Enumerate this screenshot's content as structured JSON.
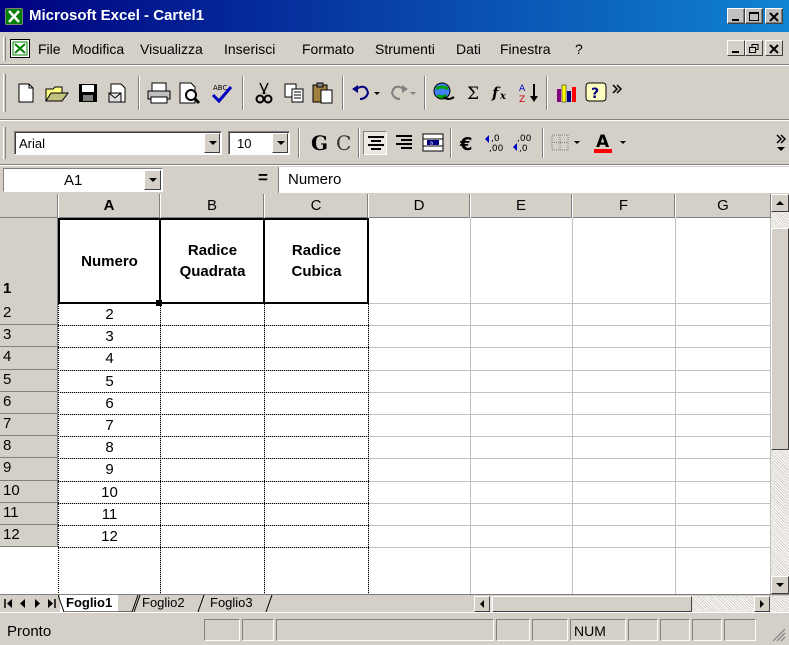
{
  "window": {
    "title": "Microsoft Excel - Cartel1"
  },
  "menu": {
    "items": [
      "File",
      "Modifica",
      "Visualizza",
      "Inserisci",
      "Formato",
      "Strumenti",
      "Dati",
      "Finestra",
      "?"
    ]
  },
  "toolbar_standard": {
    "icons": [
      "new-icon",
      "open-icon",
      "save-icon",
      "email-icon",
      "print-icon",
      "print-preview-icon",
      "spelling-icon",
      "cut-icon",
      "copy-icon",
      "paste-icon",
      "undo-icon",
      "redo-icon",
      "hyperlink-icon",
      "autosum-icon",
      "function-icon",
      "sort-ascending-icon",
      "chart-wizard-icon",
      "help-icon"
    ]
  },
  "toolbar_formatting": {
    "font": "Arial",
    "size": "10",
    "bold_label": "G",
    "italic_label": "C"
  },
  "formula_bar": {
    "name_box": "A1",
    "equals": "=",
    "value": "Numero"
  },
  "sheet": {
    "columns": [
      "A",
      "B",
      "C",
      "D",
      "E",
      "F",
      "G"
    ],
    "rows": [
      "1",
      "2",
      "3",
      "4",
      "5",
      "6",
      "7",
      "8",
      "9",
      "10",
      "11",
      "12"
    ],
    "headers": {
      "a1": "Numero",
      "b1_line1": "Radice",
      "b1_line2": "Quadrata",
      "c1_line1": "Radice",
      "c1_line2": "Cubica"
    },
    "values": [
      "2",
      "3",
      "4",
      "5",
      "6",
      "7",
      "8",
      "9",
      "10",
      "11",
      "12"
    ]
  },
  "tabs": [
    "Foglio1",
    "Foglio2",
    "Foglio3"
  ],
  "status": {
    "ready": "Pronto",
    "num": "NUM"
  }
}
